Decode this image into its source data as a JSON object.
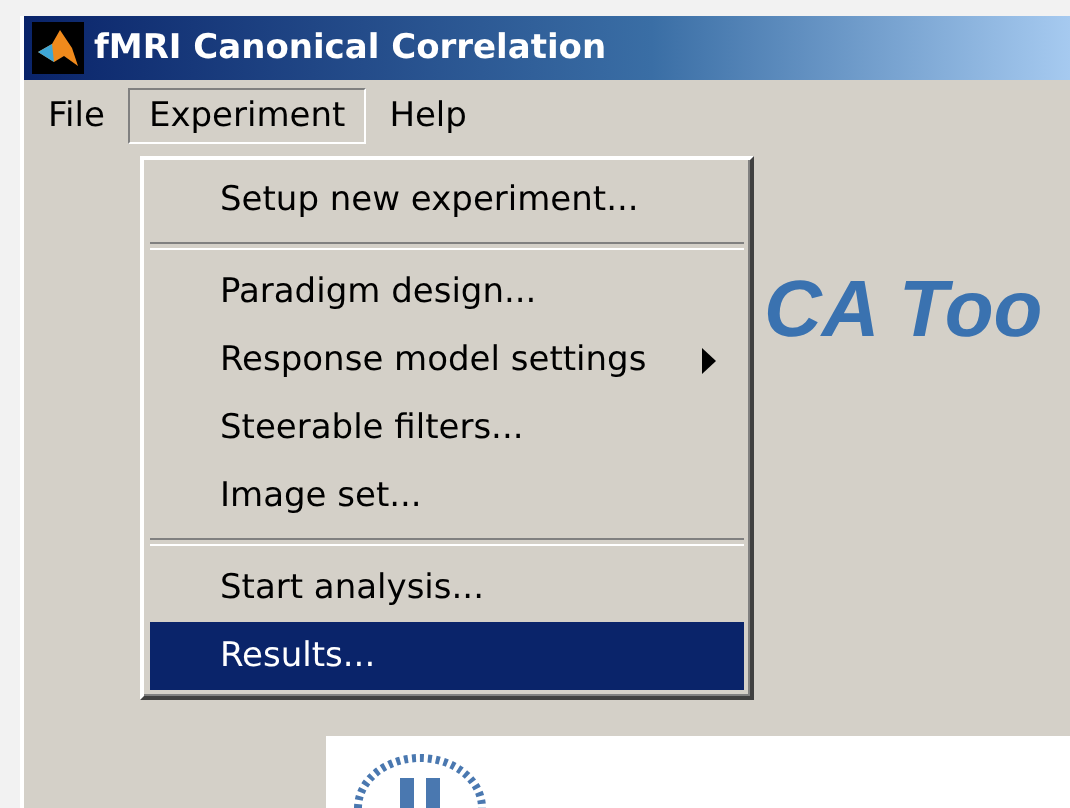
{
  "window": {
    "title": "fMRI Canonical Correlation"
  },
  "menu_bar": [
    {
      "label": "File",
      "selected": false
    },
    {
      "label": "Experiment",
      "selected": true
    },
    {
      "label": "Help",
      "selected": false
    }
  ],
  "dropdown": {
    "groups": [
      [
        {
          "label": "Setup new experiment...",
          "submenu": false,
          "selected": false
        }
      ],
      [
        {
          "label": "Paradigm design...",
          "submenu": false,
          "selected": false
        },
        {
          "label": "Response model settings",
          "submenu": true,
          "selected": false
        },
        {
          "label": "Steerable filters...",
          "submenu": false,
          "selected": false
        },
        {
          "label": "Image set...",
          "submenu": false,
          "selected": false
        }
      ],
      [
        {
          "label": "Start analysis...",
          "submenu": false,
          "selected": false
        },
        {
          "label": "Results...",
          "submenu": false,
          "selected": true
        }
      ]
    ]
  },
  "banner": {
    "heading": "CA Too"
  }
}
